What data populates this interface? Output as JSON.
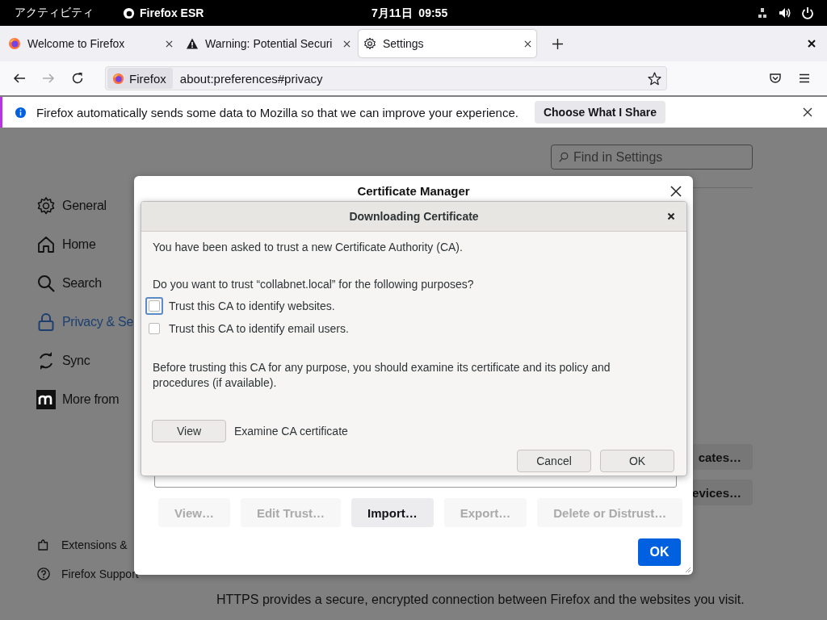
{
  "top_bar": {
    "activities": "アクティビティ",
    "app": "Firefox ESR",
    "clock": "7月11日  09:55"
  },
  "tabs": [
    {
      "label": "Welcome to Firefox",
      "kind": "firefox",
      "selected": false
    },
    {
      "label": "Warning: Potential Securi",
      "kind": "warning",
      "selected": false
    },
    {
      "label": "Settings",
      "kind": "gear",
      "selected": true
    }
  ],
  "nav": {
    "identity": "Firefox",
    "url": "about:preferences#privacy",
    "forward_disabled": true
  },
  "notification": {
    "text": "Firefox automatically sends some data to Mozilla so that we can improve your experience.",
    "button": "Choose What I Share"
  },
  "settings": {
    "search_placeholder": "Find in Settings",
    "sidebar": [
      {
        "label": "General",
        "kind": "gear",
        "selected": false
      },
      {
        "label": "Home",
        "kind": "home",
        "selected": false
      },
      {
        "label": "Search",
        "kind": "search",
        "selected": false
      },
      {
        "label": "Privacy & Se",
        "kind": "lock",
        "selected": true
      },
      {
        "label": "Sync",
        "kind": "sync",
        "selected": false
      },
      {
        "label": "More from",
        "kind": "mozilla",
        "selected": false
      }
    ],
    "footer": [
      {
        "label": "Extensions &",
        "kind": "puzzle"
      },
      {
        "label": "Firefox Support",
        "kind": "help"
      }
    ],
    "side_buttons": [
      "cates…",
      "evices…"
    ],
    "paragraph_lines": [
      "HTTPS provides a secure, encrypted connection between Firefox and the websites you visit."
    ]
  },
  "certificate_manager": {
    "title": "Certificate Manager",
    "buttons": [
      {
        "label": "View…",
        "disabled": true
      },
      {
        "label": "Edit Trust…",
        "disabled": true
      },
      {
        "label": "Import…",
        "disabled": false
      },
      {
        "label": "Export…",
        "disabled": true
      },
      {
        "label": "Delete or Distrust…",
        "disabled": true
      }
    ],
    "ok": "OK"
  },
  "download_dialog": {
    "title": "Downloading Certificate",
    "intro": "You have been asked to trust a new Certificate Authority (CA).",
    "question": "Do you want to trust “collabnet.local” for the following purposes?",
    "options": [
      {
        "label": "Trust this CA to identify websites.",
        "checked": false,
        "focused": true
      },
      {
        "label": "Trust this CA to identify email users.",
        "checked": false,
        "focused": false
      }
    ],
    "advice": "Before trusting this CA for any purpose, you should examine its certificate and its policy and procedures (if available).",
    "view_button": "View",
    "view_label": "Examine CA certificate",
    "buttons": [
      "Cancel",
      "OK"
    ]
  }
}
